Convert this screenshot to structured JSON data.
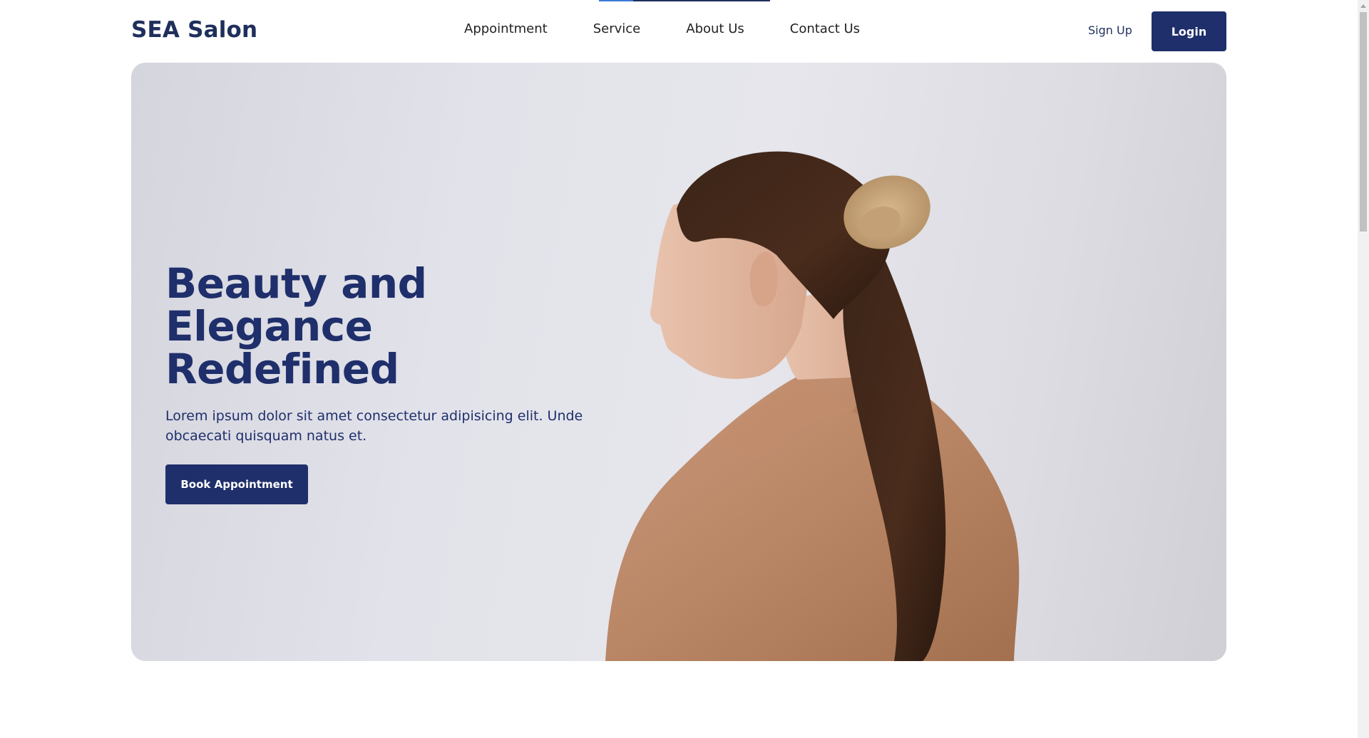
{
  "header": {
    "logo": "SEA Salon",
    "nav": [
      "Appointment",
      "Service",
      "About Us",
      "Contact Us"
    ],
    "signup_label": "Sign Up",
    "login_label": "Login"
  },
  "hero": {
    "title_line1": "Beauty and",
    "title_line2": "Elegance Redefined",
    "description": "Lorem ipsum dolor sit amet consectetur adipisicing elit. Unde obcaecati quisquam natus et.",
    "cta_label": "Book Appointment",
    "image_alt": "woman-with-ponytail-photo"
  },
  "colors": {
    "primary": "#1f2f6b",
    "hero_bg": "#e2e2ea"
  }
}
